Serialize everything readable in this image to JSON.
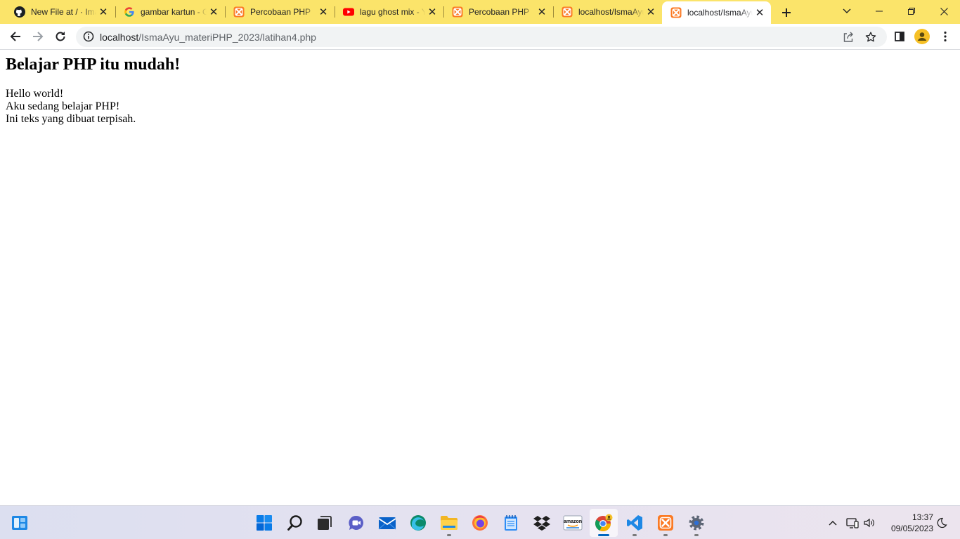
{
  "browser": {
    "tabs": [
      {
        "title": "New File at / · Ima",
        "icon": "github-icon"
      },
      {
        "title": "gambar kartun - G",
        "icon": "google-icon"
      },
      {
        "title": "Percobaan PHP",
        "icon": "xampp-icon"
      },
      {
        "title": "lagu ghost mix - Y",
        "icon": "youtube-icon"
      },
      {
        "title": "Percobaan PHP",
        "icon": "xampp-icon"
      },
      {
        "title": "localhost/IsmaAyu",
        "icon": "xampp-icon"
      },
      {
        "title": "localhost/IsmaAyu",
        "icon": "xampp-icon",
        "active": true
      }
    ],
    "url": {
      "host": "localhost",
      "path": "/IsmaAyu_materiPHP_2023/latihan4.php"
    },
    "colors": {
      "tabstrip": "#fbe46a",
      "active_tab": "#ffffff",
      "omnibox": "#f1f3f4"
    }
  },
  "page": {
    "heading": "Belajar PHP itu mudah!",
    "lines": [
      "Hello world!",
      "Aku sedang belajar PHP!",
      "Ini teks yang dibuat terpisah."
    ]
  },
  "taskbar": {
    "apps": [
      "start-icon",
      "search-icon",
      "task-view-icon",
      "chat-icon",
      "mail-icon",
      "edge-icon",
      "file-explorer-icon",
      "firefox-icon",
      "notepad-icon",
      "dropbox-icon",
      "amazon-icon",
      "chrome-icon",
      "vscode-icon",
      "xampp-icon",
      "settings-icon"
    ],
    "amazon_label": "amazon",
    "time": "13:37",
    "date": "09/05/2023"
  }
}
